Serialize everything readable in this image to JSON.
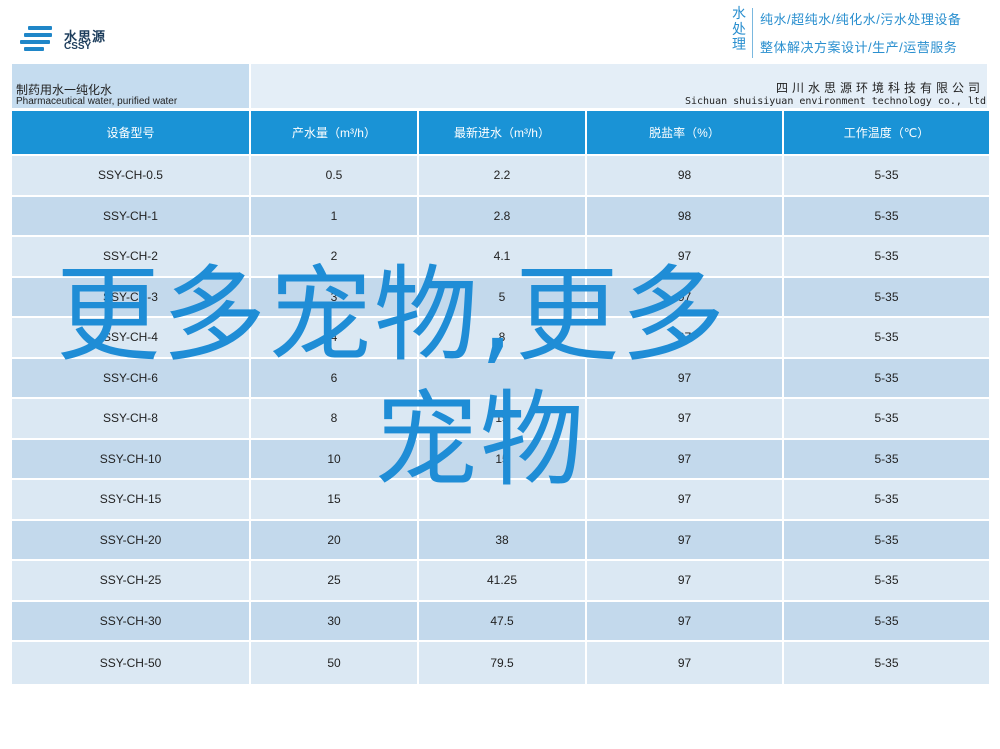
{
  "header": {
    "logo": {
      "cn": "水思源",
      "en": "CSSY"
    },
    "slogan_vertical": [
      "水",
      "处",
      "理"
    ],
    "slogan_line1": "纯水/超纯水/纯化水/污水处理设备",
    "slogan_line2": "整体解决方案设计/生产/运营服务"
  },
  "title_band": {
    "title_cn": "制药用水一纯化水",
    "title_en": "Pharmaceutical water, purified water",
    "company_cn": "四川水思源环境科技有限公司",
    "company_en": "Sichuan shuisiyuan environment technology co., ltd"
  },
  "table": {
    "headers": [
      "设备型号",
      "产水量（m³/h）",
      "最新进水（m³/h）",
      "脱盐率（%）",
      "工作温度（℃）"
    ],
    "rows": [
      [
        "SSY-CH-0.5",
        "0.5",
        "2.2",
        "98",
        "5-35"
      ],
      [
        "SSY-CH-1",
        "1",
        "2.8",
        "98",
        "5-35"
      ],
      [
        "SSY-CH-2",
        "2",
        "4.1",
        "97",
        "5-35"
      ],
      [
        "SSY-CH-3",
        "3",
        "5",
        "97",
        "5-35"
      ],
      [
        "SSY-CH-4",
        "4",
        "8",
        "97",
        "5-35"
      ],
      [
        "SSY-CH-6",
        "6",
        "",
        "97",
        "5-35"
      ],
      [
        "SSY-CH-8",
        "8",
        "15",
        "97",
        "5-35"
      ],
      [
        "SSY-CH-10",
        "10",
        "15",
        "97",
        "5-35"
      ],
      [
        "SSY-CH-15",
        "15",
        "",
        "97",
        "5-35"
      ],
      [
        "SSY-CH-20",
        "20",
        "38",
        "97",
        "5-35"
      ],
      [
        "SSY-CH-25",
        "25",
        "41.25",
        "97",
        "5-35"
      ],
      [
        "SSY-CH-30",
        "30",
        "47.5",
        "97",
        "5-35"
      ],
      [
        "SSY-CH-50",
        "50",
        "79.5",
        "97",
        "5-35"
      ]
    ]
  },
  "overlay": {
    "line1": "更多宠物,更多",
    "line2": "宠物"
  },
  "colors": {
    "header_blue": "#1a93d6",
    "row_light": "#dbe8f3",
    "row_dark": "#c3d9ec",
    "overlay_blue": "#1f8dd6"
  }
}
